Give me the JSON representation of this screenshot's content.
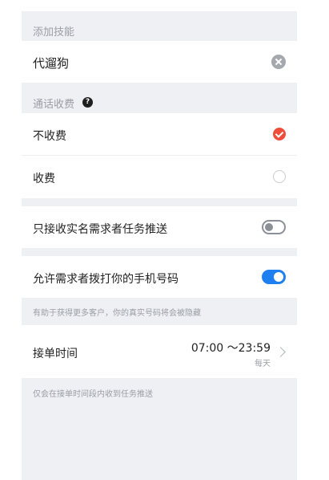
{
  "add_skill": {
    "section_title": "添加技能",
    "skill_name": "代遛狗"
  },
  "call_fee": {
    "section_title": "通话收费",
    "help_symbol": "?",
    "options": [
      {
        "label": "不收费",
        "selected": true
      },
      {
        "label": "收费",
        "selected": false
      }
    ]
  },
  "verified_only": {
    "label": "只接收实名需求者任务推送",
    "enabled": false
  },
  "allow_call": {
    "label": "允许需求者拨打你的手机号码",
    "enabled": true,
    "hint": "有助于获得更多客户，你的真实号码将会被隐藏"
  },
  "order_time": {
    "label": "接单时间",
    "range": "07:00 ～23:59",
    "repeat": "每天",
    "hint": "仅会在接单时间段内收到任务推送"
  },
  "colors": {
    "accent_blue": "#1e7ff0",
    "accent_red": "#ee4d3b",
    "background": "#eef0f3"
  }
}
